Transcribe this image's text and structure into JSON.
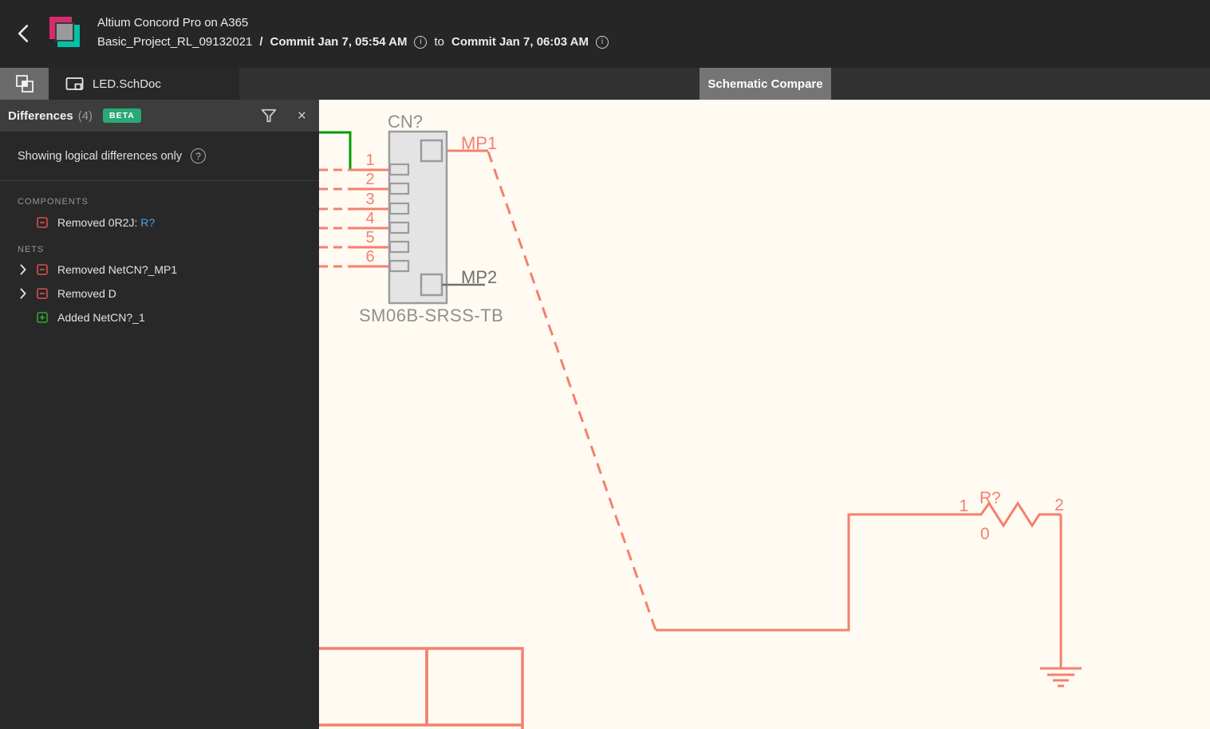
{
  "colors": {
    "salmon": "#f4806e",
    "green-wire": "#009b00",
    "beta": "#2aa875",
    "link": "#4aa3f5",
    "removed": "#d94f4f",
    "added": "#2fa52f",
    "cream": "#fffaf2",
    "comp-gray": "#9b9b9b",
    "comp-fill": "#e4e4e4",
    "label-gray": "#8f8f8f",
    "mp2-gray": "#6f6f6f"
  },
  "header": {
    "app_title": "Altium Concord Pro on A365",
    "project_name": "Basic_Project_RL_09132021",
    "path_separator": "/",
    "commit_from": "Commit Jan 7, 05:54 AM",
    "to_word": "to",
    "commit_to": "Commit Jan 7, 06:03 AM",
    "info_glyph": "i"
  },
  "tabbar": {
    "doc_tab_label": "LED.SchDoc",
    "compare_badge": "Schematic Compare"
  },
  "panel": {
    "title": "Differences",
    "count": "(4)",
    "beta_label": "BETA",
    "close_glyph": "×",
    "subtitle": "Showing logical differences only",
    "help_glyph": "?",
    "components_header": "COMPONENTS",
    "nets_header": "NETS",
    "component_removed_text": "Removed 0R2J: ",
    "component_removed_link": "R?",
    "net_removed_1": "Removed NetCN?_MP1",
    "net_removed_2": "Removed D",
    "net_added_1": "Added NetCN?_1"
  },
  "schematic": {
    "connector": {
      "designator": "CN?",
      "part_number": "SM06B-SRSS-TB",
      "pins": [
        "1",
        "2",
        "3",
        "4",
        "5",
        "6"
      ],
      "mp1_label": "MP1",
      "mp2_label": "MP2"
    },
    "resistor": {
      "designator": "R?",
      "value": "0",
      "pin_left": "1",
      "pin_right": "2"
    }
  }
}
